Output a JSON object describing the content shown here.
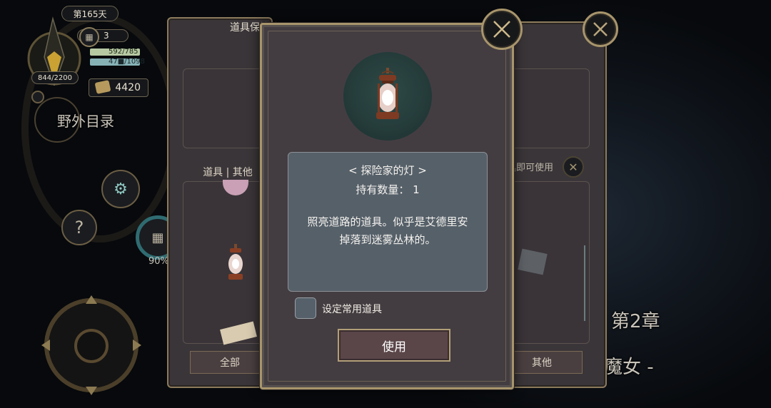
{
  "hud": {
    "day": "第165天",
    "calendar_count": "3",
    "hp": "592/785",
    "mp": "47■/1098",
    "stamina": "844/2200",
    "gold": "4420",
    "field_menu": "野外目录",
    "progress_percent": "90%"
  },
  "background": {
    "chapter": "第2章",
    "subtitle": "的魔女 -"
  },
  "left_panel": {
    "title": "道具保管箱",
    "tab_label": "道具 | 其他",
    "filter_all": "全部"
  },
  "right_panel": {
    "hint": "将道具即可使用",
    "filter_other": "其他"
  },
  "dialog": {
    "item_name": "< 探险家的灯 >",
    "quantity": "持有数量： 1",
    "description_line1": "照亮道路的道具。似乎是艾德里安",
    "description_line2": "掉落到迷雾丛林的。",
    "set_favorite_label": "设定常用道具",
    "use_button": "使用",
    "icon": "lantern-icon"
  },
  "colors": {
    "frame_gold": "#a8956c",
    "panel_bg": "#433d41",
    "info_box_bg": "#566069",
    "hp_bar": "#b7c9a2",
    "mp_bar": "#86b2b6"
  }
}
